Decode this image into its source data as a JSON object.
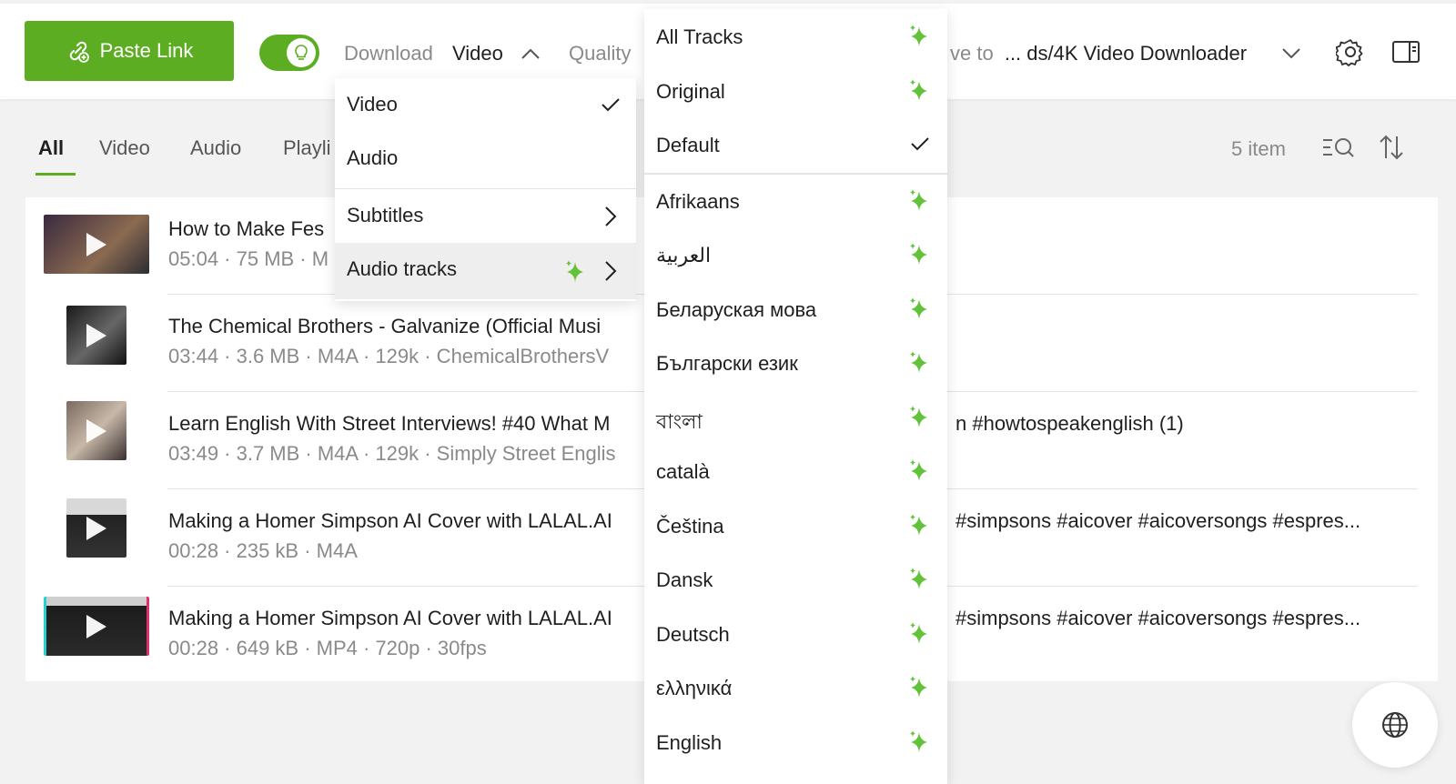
{
  "toolbar": {
    "paste_label": "Paste Link",
    "download_label": "Download",
    "download_value": "Video",
    "quality_label": "Quality",
    "save_label": "ve to",
    "save_value": "... ds/4K Video Downloader",
    "accent_color": "#5cad22"
  },
  "tabs": [
    {
      "label": "All",
      "active": true
    },
    {
      "label": "Video"
    },
    {
      "label": "Audio"
    },
    {
      "label": "Playli"
    }
  ],
  "item_count": "5 item",
  "items": [
    {
      "title": "How to Make Fes",
      "meta": "05:04 · 75 MB · M",
      "title_tail": ""
    },
    {
      "title": "The Chemical Brothers - Galvanize (Official Musi",
      "meta": "03:44 · 3.6 MB · M4A · 129k · ChemicalBrothersV",
      "title_tail": ""
    },
    {
      "title": "Learn English With Street Interviews! #40 What M",
      "meta": "03:49 · 3.7 MB · M4A · 129k · Simply Street Englis",
      "title_tail": "n #howtospeakenglish (1)"
    },
    {
      "title": "Making a Homer Simpson AI Cover with LALAL.AI",
      "meta": "00:28 · 235 kB · M4A",
      "title_tail": "#simpsons #aicover #aicoversongs #espres..."
    },
    {
      "title": "Making a Homer Simpson AI Cover with LALAL.AI",
      "meta": "00:28 · 649 kB · MP4 · 720p · 30fps",
      "title_tail": "#simpsons #aicover #aicoversongs #espres..."
    }
  ],
  "download_menu": {
    "items": [
      {
        "label": "Video",
        "checked": true
      },
      {
        "label": "Audio"
      },
      {
        "label": "Subtitles",
        "submenu": true
      },
      {
        "label": "Audio tracks",
        "submenu": true,
        "highlighted": true
      }
    ]
  },
  "audio_tracks_menu": {
    "items": [
      {
        "label": "All Tracks"
      },
      {
        "label": "Original"
      },
      {
        "label": "Default",
        "checked": true
      },
      {
        "label": "Afrikaans"
      },
      {
        "label": "العربية"
      },
      {
        "label": "Беларуская мова"
      },
      {
        "label": "Български език"
      },
      {
        "label": "বাংলা"
      },
      {
        "label": "català"
      },
      {
        "label": "Čeština"
      },
      {
        "label": "Dansk"
      },
      {
        "label": "Deutsch"
      },
      {
        "label": "ελληνικά"
      },
      {
        "label": "English"
      }
    ]
  }
}
